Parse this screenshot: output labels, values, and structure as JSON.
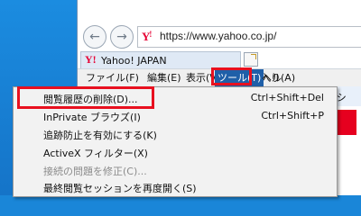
{
  "address_bar": {
    "url": "https://www.yahoo.co.jp/"
  },
  "tab": {
    "title": "Yahoo! JAPAN"
  },
  "menubar": {
    "items": [
      {
        "label": "ファイル(F)"
      },
      {
        "label": "編集(E)"
      },
      {
        "label": "表示(V)"
      },
      {
        "label": "お気に入り(A)"
      },
      {
        "label": "ツール(T)"
      },
      {
        "label": "ヘル"
      }
    ]
  },
  "right_tab": {
    "title": "Yahoo!シ"
  },
  "tools_menu": {
    "items": [
      {
        "label": "閲覧履歴の削除(D)...",
        "shortcut": "Ctrl+Shift+Del"
      },
      {
        "label": "InPrivate ブラウズ(I)",
        "shortcut": "Ctrl+Shift+P"
      },
      {
        "label": "追跡防止を有効にする(K)",
        "shortcut": ""
      },
      {
        "label": "ActiveX フィルター(X)",
        "shortcut": ""
      },
      {
        "label": "接続の問題を修正(C)...",
        "shortcut": ""
      },
      {
        "label": "最終閲覧セッションを再度開く(S)",
        "shortcut": ""
      }
    ]
  },
  "icons": {
    "back": "back-arrow-icon",
    "forward": "forward-arrow-icon",
    "favicon": "yahoo-favicon-icon",
    "new_tab": "new-tab-icon"
  },
  "colors": {
    "desktop": "#1a86d8",
    "highlight_border": "#e8101f",
    "menu_active": "#1f5fa8",
    "yahoo_red": "#e60033"
  }
}
